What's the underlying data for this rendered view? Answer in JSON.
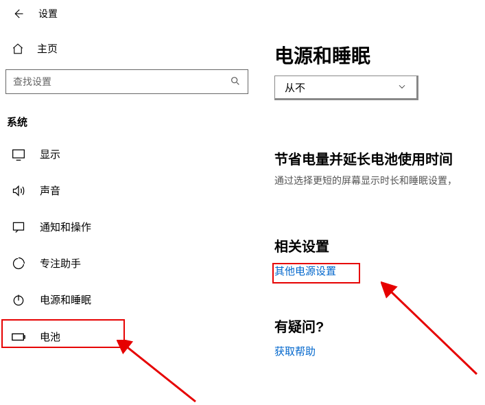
{
  "header": {
    "settings_label": "设置"
  },
  "sidebar": {
    "home_label": "主页",
    "search_placeholder": "查找设置",
    "section_label": "系统",
    "items": [
      {
        "label": "显示",
        "icon": "display"
      },
      {
        "label": "声音",
        "icon": "sound"
      },
      {
        "label": "通知和操作",
        "icon": "notifications"
      },
      {
        "label": "专注助手",
        "icon": "focus"
      },
      {
        "label": "电源和睡眠",
        "icon": "power"
      },
      {
        "label": "电池",
        "icon": "battery"
      }
    ]
  },
  "main": {
    "title": "电源和睡眠",
    "dropdown_value": "从不",
    "battery_heading": "节省电量并延长电池使用时间",
    "battery_desc": "通过选择更短的屏幕显示时长和睡眠设置，",
    "related_heading": "相关设置",
    "related_link": "其他电源设置",
    "question_heading": "有疑问?",
    "help_link": "获取帮助"
  }
}
